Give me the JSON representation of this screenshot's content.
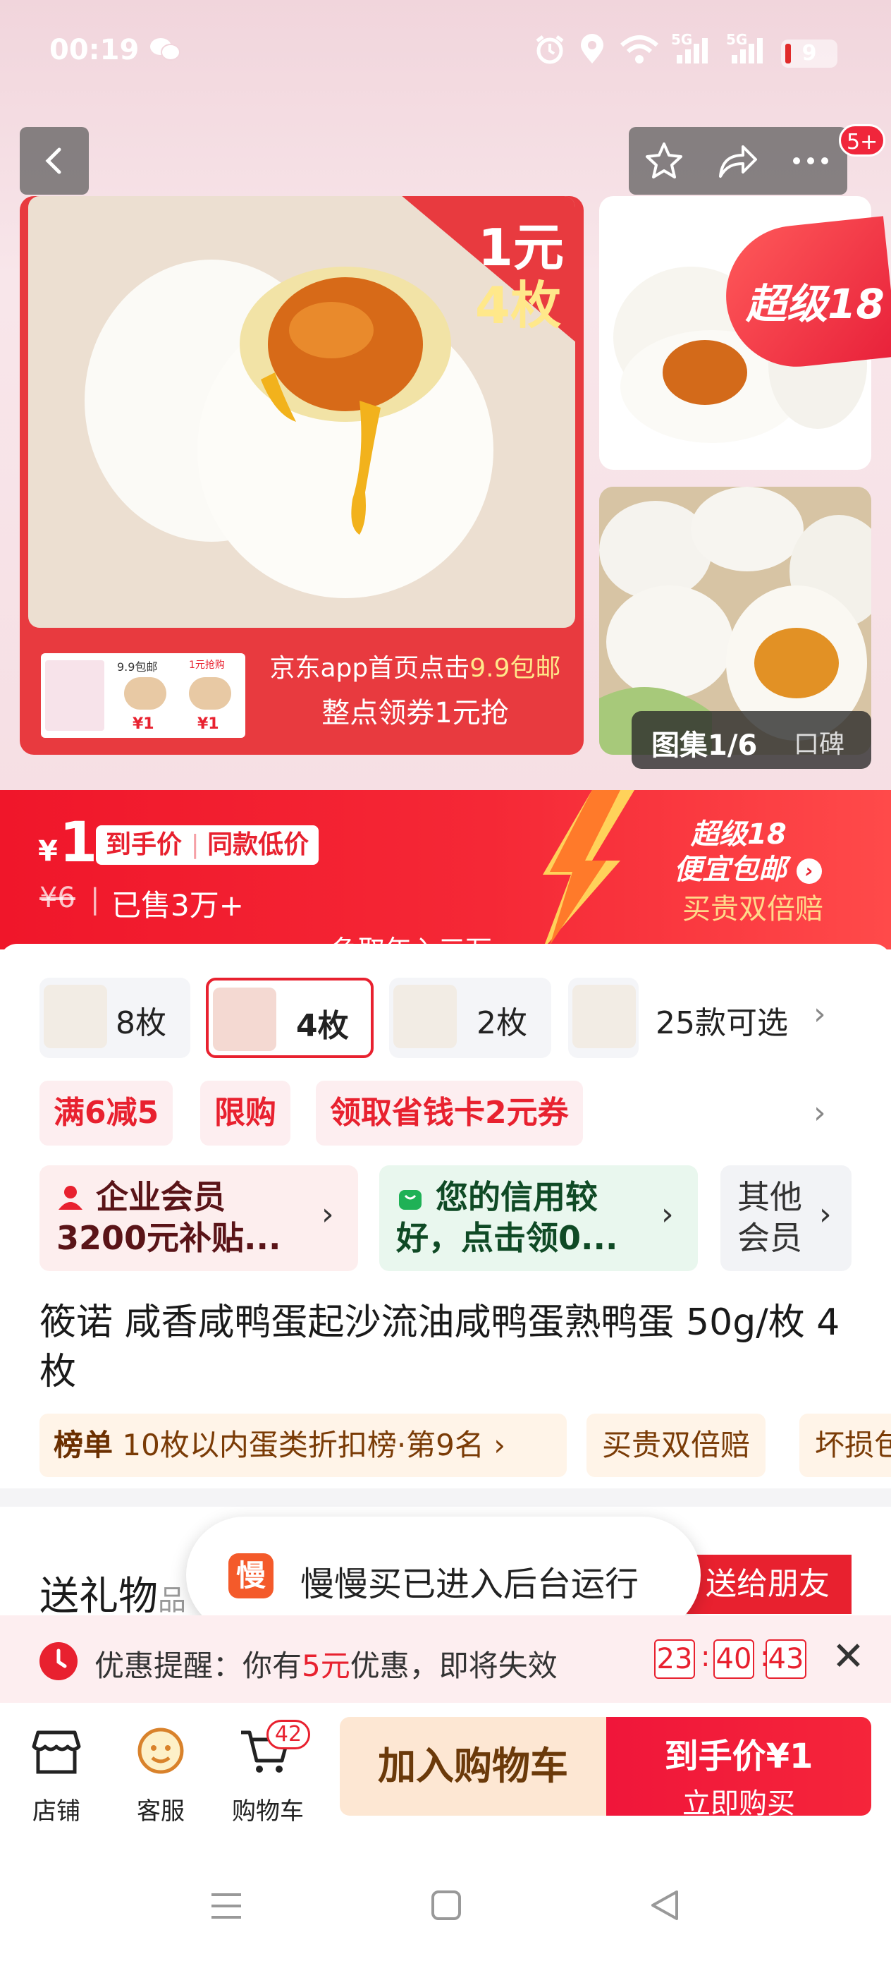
{
  "status": {
    "time": "00:19",
    "battery": "9",
    "signal_labels": [
      "5G",
      "5G"
    ]
  },
  "header": {
    "back_icon": "chevron-left-icon",
    "actions": [
      "star-icon",
      "share-icon",
      "more-icon"
    ],
    "message_badge": "5+"
  },
  "gallery": {
    "corner_line1": "1元",
    "corner_line2": "4枚",
    "promo_thumb_labels": [
      "9.9包邮",
      "1元抢购",
      "¥1",
      "¥1"
    ],
    "promo_line1_prefix": "京东app首页点击",
    "promo_line1_highlight": "9.9包邮",
    "promo_line2": "整点领券1元抢",
    "side_badge": "超级18",
    "counter": "图集1/6",
    "counter_secondary": "口碑"
  },
  "price": {
    "currency": "¥",
    "value": "1",
    "tag1": "到手价",
    "tag2": "同款低价",
    "original": "¥6",
    "sold": "已售3万+",
    "promo_title": "超级18",
    "promo_sub": "便宜包邮",
    "promo_guarantee": "买贵双倍赔",
    "scroll_hint": "争取年入三万"
  },
  "variants": [
    {
      "label": "8枚",
      "selected": false
    },
    {
      "label": "4枚",
      "selected": true
    },
    {
      "label": "2枚",
      "selected": false
    },
    {
      "label": "25款可选",
      "selected": false
    }
  ],
  "coupons": [
    "满6减5",
    "限购",
    "领取省钱卡2元券"
  ],
  "members": {
    "enterprise": "企业会员 3200元补贴...",
    "enterprise_line1": "企业会员",
    "enterprise_line2": "3200元补贴...",
    "credit_line1": "您的信用较",
    "credit_line2": "好，点击领0...",
    "other_line1": "其他",
    "other_line2": "会员"
  },
  "product": {
    "title": "筱诺 咸香咸鸭蛋起沙流油咸鸭蛋熟鸭蛋 50g/枚 4枚"
  },
  "ranking": {
    "label": "榜单",
    "text": "10枚以内蛋类折扣榜·第9名",
    "tag1": "买贵双倍赔",
    "tag2": "坏损包"
  },
  "gift": {
    "title": "送礼物",
    "title_suffix": "品",
    "button": "送给朋友"
  },
  "toast": {
    "icon_char": "慢",
    "text": "慢慢买已进入后台运行"
  },
  "reminder": {
    "prefix": "优惠提醒：你有",
    "amount": "5元",
    "suffix": "优惠，即将失效",
    "hours": "23",
    "minutes": "40",
    "seconds": "43",
    "separator": ":"
  },
  "bottom_bar": {
    "store": "店铺",
    "service": "客服",
    "cart": "购物车",
    "cart_count": "42",
    "add_to_cart": "加入购物车",
    "buy_line1": "到手价¥1",
    "buy_line2": "立即购买"
  },
  "colors": {
    "brand_red": "#e8212f",
    "promo_yellow": "#ffe88a",
    "cart_button_bg": "#fde7d3"
  }
}
